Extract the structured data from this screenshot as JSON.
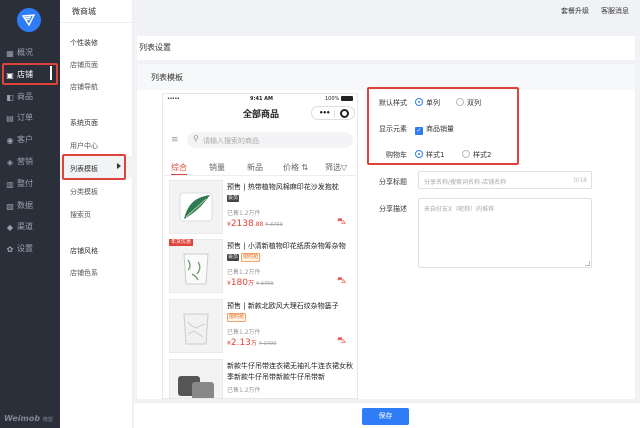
{
  "colors": {
    "accent": "#2e7cf6",
    "highlight": "#e0433a",
    "nav_bg": "#2b2f3a",
    "price": "#e0433a"
  },
  "app": {
    "title": "微商城",
    "brand": "Weimob",
    "brand_sub": "微盟"
  },
  "top_links": {
    "upgrade": "套餐升级",
    "service": "客服消息"
  },
  "main_nav": [
    {
      "label": "概况",
      "icon": "dashboard-icon"
    },
    {
      "label": "店铺",
      "icon": "store-icon",
      "active": true
    },
    {
      "label": "商品",
      "icon": "goods-icon"
    },
    {
      "label": "订单",
      "icon": "order-icon"
    },
    {
      "label": "客户",
      "icon": "customer-icon"
    },
    {
      "label": "营销",
      "icon": "marketing-icon"
    },
    {
      "label": "整付",
      "icon": "payment-icon"
    },
    {
      "label": "数据",
      "icon": "data-icon"
    },
    {
      "label": "渠道",
      "icon": "channel-icon"
    },
    {
      "label": "设置",
      "icon": "settings-icon"
    }
  ],
  "sub_nav": {
    "groups": [
      "个性装修",
      "系统页面",
      "店铺风格"
    ],
    "items": {
      "shop_page": "店铺页面",
      "shop_nav": "店铺导航",
      "user_center": "用户中心",
      "list_template": "列表模板",
      "category_template": "分类模板",
      "search_page": "搜索页",
      "shop_color": "店铺色系"
    },
    "selected": "列表模板"
  },
  "page": {
    "title": "列表设置",
    "section": "列表模板"
  },
  "phone": {
    "status": {
      "signal": "•••••",
      "time": "9:41 AM",
      "battery": "100%"
    },
    "title": "全部商品",
    "search_placeholder": "请输入搜索的商品",
    "tabs": [
      "综合",
      "销量",
      "新品",
      "价格",
      "筛选"
    ],
    "selected_tab": "综合",
    "products": [
      {
        "prefix": "预售",
        "title": "热带植物风棉麻印花沙发抱枕",
        "tag": "会员",
        "sold": "已售1.2万件",
        "price_int": "2138",
        "price_dec": ".88",
        "price_unit": "",
        "old": "¥ 3799"
      },
      {
        "badge": "年货优惠",
        "prefix": "预售",
        "title": "小清新植物印花纸质杂物筹杂物",
        "tag": "会员",
        "tag2": "限时抢",
        "sold": "已售1.2万件",
        "price_int": "180",
        "price_dec": "",
        "price_unit": "万",
        "old": "¥ 3799"
      },
      {
        "prefix": "预售",
        "title": "新款北欧风大理石纹杂物篓子",
        "tag2": "限时抢",
        "sold": "已售1.2万件",
        "price_int": "2.13",
        "price_dec": "",
        "price_unit": "万",
        "old": "¥ 3799"
      },
      {
        "prefix": "",
        "title": "新款牛仔吊带连衣裙无袖礼牛连衣裙女秋季新款牛仔吊带新款牛仔吊带新",
        "sold": "已售1.2万件"
      }
    ]
  },
  "settings": {
    "default_style": {
      "label": "默认样式",
      "options": [
        "单列",
        "双列"
      ],
      "selected": "单列"
    },
    "display": {
      "label": "显示元素",
      "option": "商品销量",
      "checked": true
    },
    "cart": {
      "label": "购物车",
      "options": [
        "样式1",
        "样式2"
      ],
      "selected": "样式1"
    },
    "share_title": {
      "label": "分享标题",
      "placeholder": "分享名称/搜索词名称-店铺名称",
      "count": "0/18"
    },
    "share_desc": {
      "label": "分享描述",
      "placeholder": "来自好友X（昵称）的推荐"
    }
  },
  "save_label": "保存"
}
